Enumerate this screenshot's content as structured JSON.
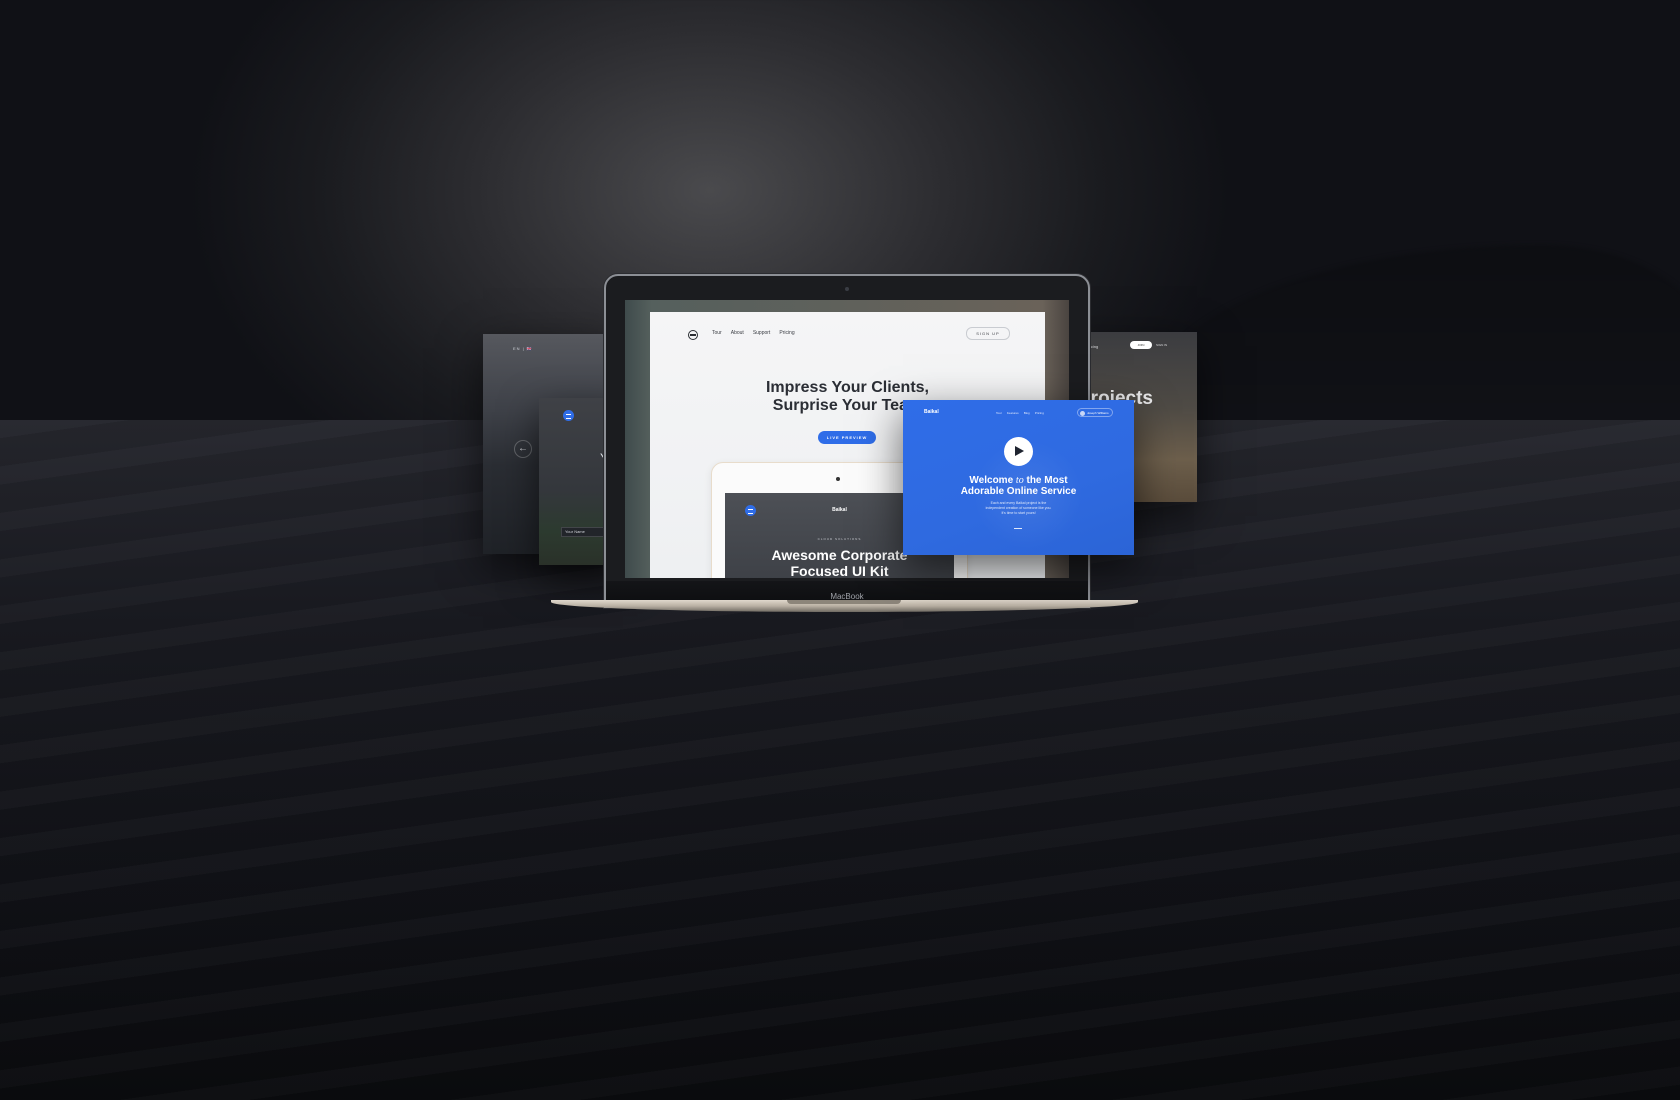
{
  "left_card": {
    "nav": "EN | 🇬🇧",
    "arrow": "←"
  },
  "left_front_card": {
    "field_placeholder": "Your Name",
    "heading_fragment": "Y"
  },
  "right_card": {
    "menu": "Pricing",
    "button": "JOIN",
    "link": "SIGN IN",
    "heading": "Projects"
  },
  "laptop": {
    "brand": "MacBook"
  },
  "main_page": {
    "nav": [
      "Tour",
      "About",
      "Support",
      "Pricing"
    ],
    "signup": "SIGN UP",
    "heading_line1": "Impress Your Clients,",
    "heading_line2": "Surprise Your Team",
    "cta": "LIVE PREVIEW"
  },
  "tablet": {
    "brand": "Baikal",
    "small": "CLOUD SOLUTIONS",
    "heading_line1": "Awesome Corporate",
    "heading_line2": "Focused UI Kit"
  },
  "blue_card": {
    "brand": "Baikal",
    "nav": [
      "Tour",
      "Features",
      "Blog",
      "Pricing"
    ],
    "user": "Joseph Williams",
    "heading_a": "Welcome",
    "heading_b": "to",
    "heading_c": "the Most",
    "heading_line2": "Adorable Online Service",
    "sub_line1": "Each and every Baikal project is the",
    "sub_line2": "independent creation of someone like you.",
    "sub_line3": "It's time to start yours!"
  },
  "colors": {
    "accent": "#2f6de8"
  }
}
